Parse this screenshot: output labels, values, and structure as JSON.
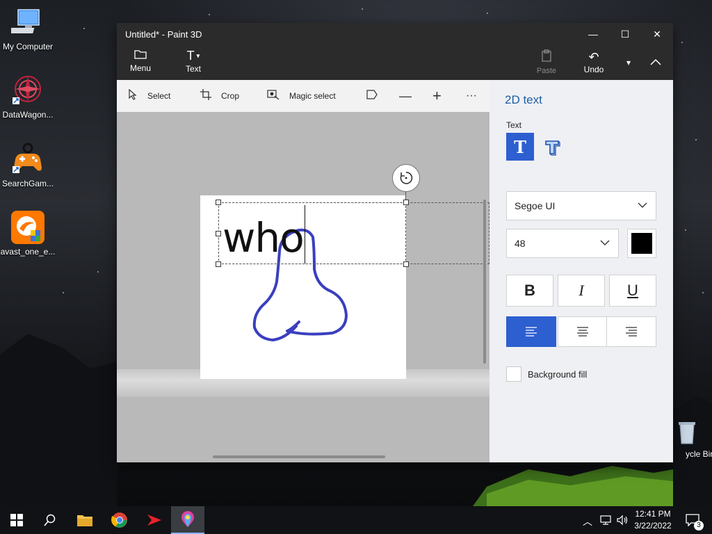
{
  "desktop": {
    "icons": [
      {
        "label": "My Computer",
        "icon": "computer-icon"
      },
      {
        "label": "DataWagon...",
        "icon": "datawagon-icon"
      },
      {
        "label": "SearchGam...",
        "icon": "gamepad-icon"
      },
      {
        "label": "avast_one_e...",
        "icon": "avast-icon"
      },
      {
        "label": "ycle Bin",
        "icon": "recycle-bin-icon"
      }
    ]
  },
  "window": {
    "title": "Untitled* - Paint 3D",
    "controls": {
      "minimize": "—",
      "maximize": "☐",
      "close": "✕"
    }
  },
  "ribbon": {
    "menu_label": "Menu",
    "text_label": "Text",
    "paste_label": "Paste",
    "undo_label": "Undo"
  },
  "toolbar": {
    "select_label": "Select",
    "crop_label": "Crop",
    "magic_select_label": "Magic select"
  },
  "canvas": {
    "text": "who",
    "stroke_color": "#3a3fbf"
  },
  "panel": {
    "title": "2D text",
    "text_section_label": "Text",
    "font": "Segoe UI",
    "size": "48",
    "color": "#000000",
    "bold_label": "B",
    "italic_label": "I",
    "underline_label": "U",
    "alignment": "left",
    "background_fill_label": "Background fill",
    "background_fill_checked": false,
    "accent_color": "#2d5fd1"
  },
  "taskbar": {
    "time": "12:41 PM",
    "date": "3/22/2022",
    "notification_count": "3"
  }
}
